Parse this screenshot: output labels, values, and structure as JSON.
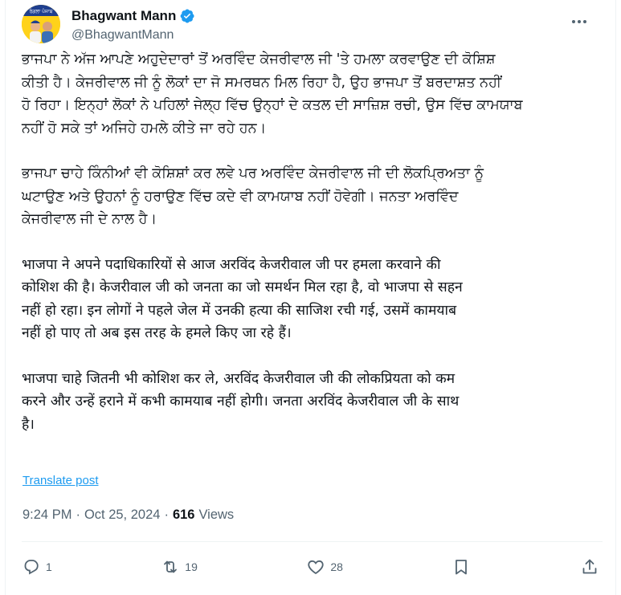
{
  "author": {
    "display_name": "Bhagwant Mann",
    "handle": "@BhagwantMann",
    "avatar_text": "ਰੰਗਲਾ ਪੰਜਾਬ",
    "verified": true
  },
  "post": {
    "paragraphs": [
      "ਭਾਜਪਾ ਨੇ ਅੱਜ ਆਪਣੇ ਅਹੁਦੇਦਾਰਾਂ ਤੋਂ ਅਰਵਿੰਦ ਕੇਜਰੀਵਾਲ ਜੀ 'ਤੇ ਹਮਲਾ ਕਰਵਾਉਣ ਦੀ ਕੋਸ਼ਿਸ਼\nਕੀਤੀ ਹੈ। ਕੇਜਰੀਵਾਲ ਜੀ ਨੂੰ ਲੋਕਾਂ ਦਾ ਜੋ ਸਮਰਥਨ ਮਿਲ ਰਿਹਾ ਹੈ, ਉਹ ਭਾਜਪਾ ਤੋਂ ਬਰਦਾਸ਼ਤ ਨਹੀਂ\nਹੋ ਰਿਹਾ। ਇਨ੍ਹਾਂ ਲੋਕਾਂ ਨੇ ਪਹਿਲਾਂ ਜੇਲ੍ਹ ਵਿੱਚ ਉਨ੍ਹਾਂ ਦੇ ਕਤਲ ਦੀ ਸਾਜ਼ਿਸ਼ ਰਚੀ, ਉਸ ਵਿੱਚ ਕਾਮਯਾਬ\nਨਹੀਂ ਹੋ ਸਕੇ ਤਾਂ ਅਜਿਹੇ ਹਮਲੇ ਕੀਤੇ ਜਾ ਰਹੇ ਹਨ।",
      "ਭਾਜਪਾ ਚਾਹੇ ਕਿੰਨੀਆਂ ਵੀ ਕੋਸ਼ਿਸ਼ਾਂ ਕਰ ਲਵੇ ਪਰ ਅਰਵਿੰਦ ਕੇਜਰੀਵਾਲ ਜੀ ਦੀ ਲੋਕਪ੍ਰਿਅਤਾ ਨੂੰ\nਘਟਾਉਣ ਅਤੇ ਉਹਨਾਂ ਨੂੰ ਹਰਾਉਣ ਵਿੱਚ ਕਦੇ ਵੀ ਕਾਮਯਾਬ ਨਹੀਂ ਹੋਵੇਗੀ। ਜਨਤਾ ਅਰਵਿੰਦ\nਕੇਜਰੀਵਾਲ ਜੀ ਦੇ ਨਾਲ ਹੈ।",
      "भाजपा ने अपने पदाधिकारियों से आज अरविंद केजरीवाल जी पर हमला करवाने की\nकोशिश की है। केजरीवाल जी को जनता का जो समर्थन मिल रहा है, वो भाजपा से सहन\nनहीं हो रहा। इन लोगों ने पहले जेल में उनकी हत्या की साजिश रची गई, उसमें कामयाब\nनहीं हो पाए तो अब इस तरह के हमले किए जा रहे हैं।",
      "भाजपा चाहे जितनी भी कोशिश कर ले, अरविंद केजरीवाल जी की लोकप्रियता को कम\nकरने और उन्हें हराने में कभी कामयाब नहीं होगी। जनता अरविंद केजरीवाल जी के साथ\nहै।"
    ],
    "translate_label": "Translate post",
    "time": "9:24 PM",
    "separator": "·",
    "date": "Oct 25, 2024",
    "views_count": "616",
    "views_label": "Views"
  },
  "actions": {
    "reply_count": "1",
    "repost_count": "19",
    "like_count": "28"
  },
  "colors": {
    "accent": "#1d9bf0",
    "muted": "#536471",
    "text": "#0f1419",
    "avatar_bg": "#ffd21a"
  },
  "icons": [
    "verified-badge-icon",
    "more-icon",
    "reply-icon",
    "repost-icon",
    "like-icon",
    "bookmark-icon",
    "share-icon"
  ]
}
